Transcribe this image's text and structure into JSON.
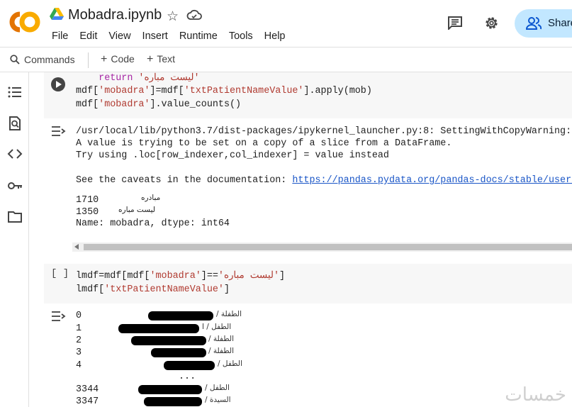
{
  "header": {
    "title": "Mobadra.ipynb",
    "menu": [
      "File",
      "Edit",
      "View",
      "Insert",
      "Runtime",
      "Tools",
      "Help"
    ],
    "share_label": "Share",
    "colors": {
      "logo_orange": "#f9ab00",
      "logo_dark_orange": "#e37400",
      "share_bg": "#c2e7ff"
    }
  },
  "toolbar": {
    "commands_label": "Commands",
    "code_label": "Code",
    "text_label": "Text"
  },
  "cell1": {
    "line0_kw": "return",
    "line0_str": "'ليست مباره'",
    "line1_a": "mdf[",
    "line1_s1": "'mobadra'",
    "line1_b": "]=mdf[",
    "line1_s2": "'txtPatientNameValue'",
    "line1_c": "].apply(mob)",
    "line2_a": "mdf[",
    "line2_s": "'mobadra'",
    "line2_b": "].value_counts()"
  },
  "output1": {
    "warn1": "/usr/local/lib/python3.7/dist-packages/ipykernel_launcher.py:8: SettingWithCopyWarning:",
    "warn2": "A value is trying to be set on a copy of a slice from a DataFrame.",
    "warn3": "Try using .loc[row_indexer,col_indexer] = value instead",
    "caveats": "See the caveats in the documentation: ",
    "link": "https://pandas.pydata.org/pandas-docs/stable/user_gui",
    "count1": "1710",
    "label1": "مبادره",
    "count2": "1350",
    "label2": "ليست مباره",
    "footer": "Name: mobadra, dtype: int64"
  },
  "cell2": {
    "bracket": "[ ]",
    "line1_a": "lmdf=mdf[mdf[",
    "line1_s1": "'mobadra'",
    "line1_b": "]==",
    "line1_s2": "'ليست مباره'",
    "line1_c": "]",
    "line2_a": "lmdf[",
    "line2_s": "'txtPatientNameValue'",
    "line2_b": "]"
  },
  "output2": {
    "rows": [
      {
        "index": "0",
        "text": "الطفلة /"
      },
      {
        "index": "1",
        "text": "الطفل / ا"
      },
      {
        "index": "2",
        "text": "الطفلة /"
      },
      {
        "index": "3",
        "text": "الطفلة /"
      },
      {
        "index": "4",
        "text": "الطفل /"
      },
      {
        "index": "3344",
        "text": "الطفل /"
      },
      {
        "index": "3347",
        "text": "السيدة /"
      }
    ],
    "ellipsis": "..."
  },
  "watermark": "خمسات"
}
